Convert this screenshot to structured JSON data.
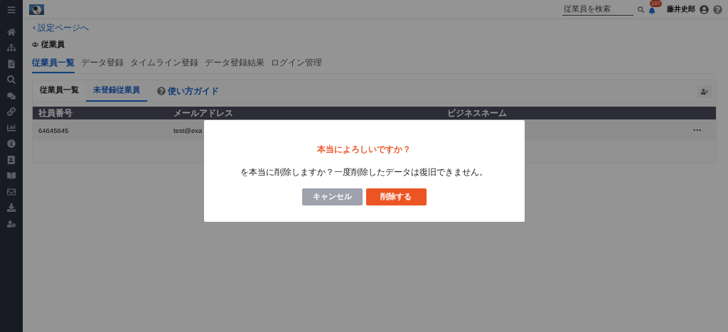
{
  "header": {
    "search": {
      "placeholder": "従業員を検索"
    },
    "notifications": {
      "count": "107"
    },
    "user": {
      "name": "藤井史郎"
    }
  },
  "back_link": "設定ページへ",
  "page_title": "従業員",
  "tabs": [
    {
      "label": "従業員一覧",
      "selected": true
    },
    {
      "label": "データ登録",
      "selected": false
    },
    {
      "label": "タイムライン登録",
      "selected": false
    },
    {
      "label": "データ登録結果",
      "selected": false
    },
    {
      "label": "ログイン管理",
      "selected": false
    }
  ],
  "subtabs": [
    {
      "label": "従業員一覧",
      "selected": false
    },
    {
      "label": "未登録従業員",
      "selected": true
    }
  ],
  "guide_link": "使い方ガイド",
  "table": {
    "columns": [
      "社員番号",
      "メールアドレス",
      "ビジネスネーム"
    ],
    "rows": [
      {
        "cells": [
          "64645645",
          "test@exa"
        ],
        "menu": "···"
      }
    ]
  },
  "dialog": {
    "title": "本当によろしいですか？",
    "message": "を本当に削除しますか？一度削除したデータは復旧できません。",
    "buttons": [
      {
        "label": "キャンセル",
        "kind": "cancel"
      },
      {
        "label": "削除する",
        "kind": "danger"
      }
    ]
  }
}
